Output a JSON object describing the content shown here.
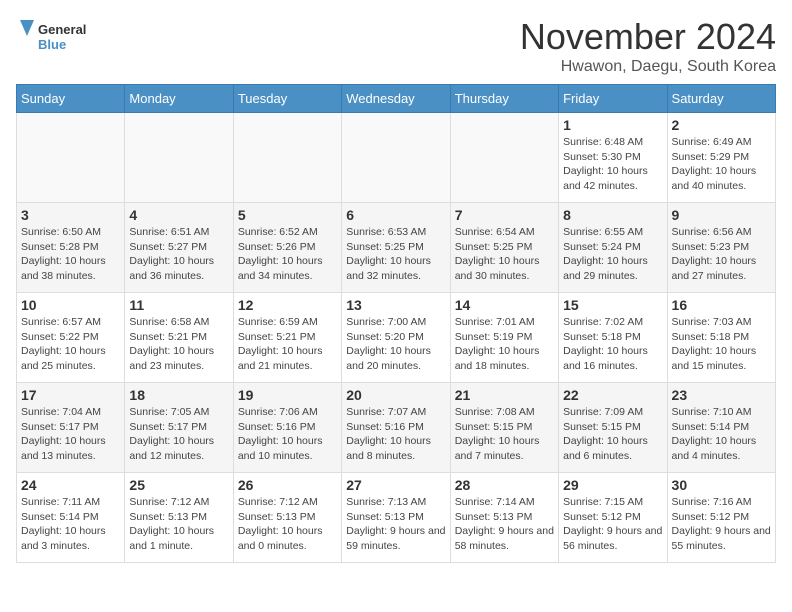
{
  "header": {
    "logo_line1": "General",
    "logo_line2": "Blue",
    "month_title": "November 2024",
    "subtitle": "Hwawon, Daegu, South Korea"
  },
  "weekdays": [
    "Sunday",
    "Monday",
    "Tuesday",
    "Wednesday",
    "Thursday",
    "Friday",
    "Saturday"
  ],
  "weeks": [
    [
      {
        "day": "",
        "info": ""
      },
      {
        "day": "",
        "info": ""
      },
      {
        "day": "",
        "info": ""
      },
      {
        "day": "",
        "info": ""
      },
      {
        "day": "",
        "info": ""
      },
      {
        "day": "1",
        "info": "Sunrise: 6:48 AM\nSunset: 5:30 PM\nDaylight: 10 hours and 42 minutes."
      },
      {
        "day": "2",
        "info": "Sunrise: 6:49 AM\nSunset: 5:29 PM\nDaylight: 10 hours and 40 minutes."
      }
    ],
    [
      {
        "day": "3",
        "info": "Sunrise: 6:50 AM\nSunset: 5:28 PM\nDaylight: 10 hours and 38 minutes."
      },
      {
        "day": "4",
        "info": "Sunrise: 6:51 AM\nSunset: 5:27 PM\nDaylight: 10 hours and 36 minutes."
      },
      {
        "day": "5",
        "info": "Sunrise: 6:52 AM\nSunset: 5:26 PM\nDaylight: 10 hours and 34 minutes."
      },
      {
        "day": "6",
        "info": "Sunrise: 6:53 AM\nSunset: 5:25 PM\nDaylight: 10 hours and 32 minutes."
      },
      {
        "day": "7",
        "info": "Sunrise: 6:54 AM\nSunset: 5:25 PM\nDaylight: 10 hours and 30 minutes."
      },
      {
        "day": "8",
        "info": "Sunrise: 6:55 AM\nSunset: 5:24 PM\nDaylight: 10 hours and 29 minutes."
      },
      {
        "day": "9",
        "info": "Sunrise: 6:56 AM\nSunset: 5:23 PM\nDaylight: 10 hours and 27 minutes."
      }
    ],
    [
      {
        "day": "10",
        "info": "Sunrise: 6:57 AM\nSunset: 5:22 PM\nDaylight: 10 hours and 25 minutes."
      },
      {
        "day": "11",
        "info": "Sunrise: 6:58 AM\nSunset: 5:21 PM\nDaylight: 10 hours and 23 minutes."
      },
      {
        "day": "12",
        "info": "Sunrise: 6:59 AM\nSunset: 5:21 PM\nDaylight: 10 hours and 21 minutes."
      },
      {
        "day": "13",
        "info": "Sunrise: 7:00 AM\nSunset: 5:20 PM\nDaylight: 10 hours and 20 minutes."
      },
      {
        "day": "14",
        "info": "Sunrise: 7:01 AM\nSunset: 5:19 PM\nDaylight: 10 hours and 18 minutes."
      },
      {
        "day": "15",
        "info": "Sunrise: 7:02 AM\nSunset: 5:18 PM\nDaylight: 10 hours and 16 minutes."
      },
      {
        "day": "16",
        "info": "Sunrise: 7:03 AM\nSunset: 5:18 PM\nDaylight: 10 hours and 15 minutes."
      }
    ],
    [
      {
        "day": "17",
        "info": "Sunrise: 7:04 AM\nSunset: 5:17 PM\nDaylight: 10 hours and 13 minutes."
      },
      {
        "day": "18",
        "info": "Sunrise: 7:05 AM\nSunset: 5:17 PM\nDaylight: 10 hours and 12 minutes."
      },
      {
        "day": "19",
        "info": "Sunrise: 7:06 AM\nSunset: 5:16 PM\nDaylight: 10 hours and 10 minutes."
      },
      {
        "day": "20",
        "info": "Sunrise: 7:07 AM\nSunset: 5:16 PM\nDaylight: 10 hours and 8 minutes."
      },
      {
        "day": "21",
        "info": "Sunrise: 7:08 AM\nSunset: 5:15 PM\nDaylight: 10 hours and 7 minutes."
      },
      {
        "day": "22",
        "info": "Sunrise: 7:09 AM\nSunset: 5:15 PM\nDaylight: 10 hours and 6 minutes."
      },
      {
        "day": "23",
        "info": "Sunrise: 7:10 AM\nSunset: 5:14 PM\nDaylight: 10 hours and 4 minutes."
      }
    ],
    [
      {
        "day": "24",
        "info": "Sunrise: 7:11 AM\nSunset: 5:14 PM\nDaylight: 10 hours and 3 minutes."
      },
      {
        "day": "25",
        "info": "Sunrise: 7:12 AM\nSunset: 5:13 PM\nDaylight: 10 hours and 1 minute."
      },
      {
        "day": "26",
        "info": "Sunrise: 7:12 AM\nSunset: 5:13 PM\nDaylight: 10 hours and 0 minutes."
      },
      {
        "day": "27",
        "info": "Sunrise: 7:13 AM\nSunset: 5:13 PM\nDaylight: 9 hours and 59 minutes."
      },
      {
        "day": "28",
        "info": "Sunrise: 7:14 AM\nSunset: 5:13 PM\nDaylight: 9 hours and 58 minutes."
      },
      {
        "day": "29",
        "info": "Sunrise: 7:15 AM\nSunset: 5:12 PM\nDaylight: 9 hours and 56 minutes."
      },
      {
        "day": "30",
        "info": "Sunrise: 7:16 AM\nSunset: 5:12 PM\nDaylight: 9 hours and 55 minutes."
      }
    ]
  ]
}
